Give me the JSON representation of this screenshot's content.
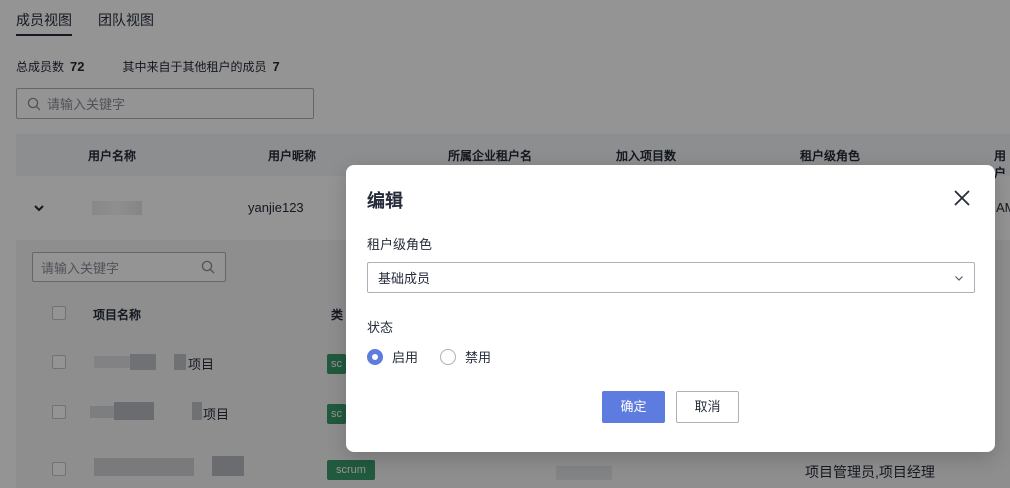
{
  "tabs": [
    {
      "label": "成员视图",
      "active": true
    },
    {
      "label": "团队视图",
      "active": false
    }
  ],
  "stats": {
    "total_label": "总成员数",
    "total_value": "72",
    "other_tenant_label": "其中来自于其他租户的成员",
    "other_tenant_value": "7"
  },
  "search": {
    "placeholder": "请输入关键字"
  },
  "table": {
    "columns": [
      "用户名称",
      "用户昵称",
      "所属企业租户名",
      "加入项目数",
      "租户级角色",
      "用户"
    ],
    "row": {
      "nickname": "yanjie123",
      "clipped": "AM"
    }
  },
  "sub_table": {
    "search_placeholder": "请输入关键字",
    "columns": [
      "项目名称",
      "类型"
    ],
    "rows": [
      {
        "name_suffix": "项目",
        "tag": "sc",
        "role": ""
      },
      {
        "name_suffix": "项目",
        "tag": "sc",
        "role": ""
      },
      {
        "name_suffix": "",
        "tag": "scrum",
        "role": "项目管理员,项目经理"
      }
    ]
  },
  "modal": {
    "title": "编辑",
    "role_label": "租户级角色",
    "role_value": "基础成员",
    "status_label": "状态",
    "status_options": [
      {
        "label": "启用",
        "checked": true
      },
      {
        "label": "禁用",
        "checked": false
      }
    ],
    "confirm_label": "确定",
    "cancel_label": "取消"
  },
  "colors": {
    "primary": "#5e7ce0",
    "tag": "#3a9c6b",
    "mask": "rgba(0,0,0,0.42)"
  }
}
